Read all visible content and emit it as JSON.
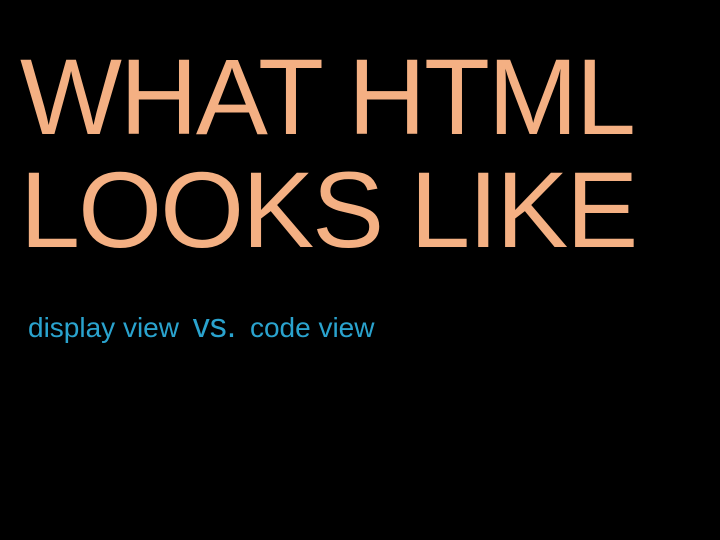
{
  "slide": {
    "title_line1": "WHAT HTML",
    "title_line2": "LOOKS LIKE",
    "subtitle_left": "display view",
    "subtitle_vs": "vs.",
    "subtitle_right": "code view"
  },
  "colors": {
    "background": "#000000",
    "title": "#f4b083",
    "subtitle": "#2aa3ce"
  }
}
